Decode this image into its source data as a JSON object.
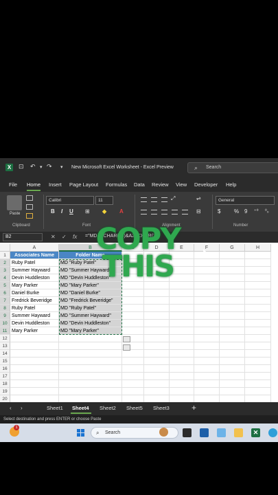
{
  "titlebar": {
    "logo": "X",
    "autosave_icon": "autosave-icon",
    "undo_icon": "undo-icon",
    "redo_icon": "redo-icon",
    "customize_icon": "customize-qat-icon",
    "title": "New Microsoft Excel Worksheet  -  Excel Preview",
    "search_placeholder": "Search"
  },
  "menu": {
    "tabs": [
      "File",
      "Home",
      "Insert",
      "Page Layout",
      "Formulas",
      "Data",
      "Review",
      "View",
      "Developer",
      "Help"
    ],
    "active": "Home"
  },
  "ribbon": {
    "paste_label": "Paste",
    "clipboard_label": "Clipboard",
    "font_name": "Calibri",
    "font_size": "11",
    "font_label": "Font",
    "alignment_label": "Alignment",
    "number_format": "General",
    "number_label": "Number",
    "bold": "B",
    "italic": "I",
    "underline": "U",
    "currency": "$",
    "percent": "%",
    "comma": "9"
  },
  "formula_bar": {
    "name_box": "B2",
    "fx": "fx",
    "formula": "=\"MD \"&CHAR(34)&A2&CHAR(34)"
  },
  "grid": {
    "columns": [
      "A",
      "B",
      "C",
      "D",
      "E",
      "F",
      "G",
      "H"
    ],
    "rows": [
      "1",
      "2",
      "3",
      "4",
      "5",
      "6",
      "7",
      "8",
      "9",
      "10",
      "11",
      "12",
      "13",
      "14",
      "15",
      "16",
      "17",
      "18",
      "19",
      "20"
    ],
    "header_a": "Associates Name",
    "header_b": "Folder Name",
    "names": [
      "Ruby Patel",
      "Summer Hayward",
      "Devin Huddleston",
      "Mary Parker",
      "Daniel Burke",
      "Fredrick Beveridge",
      "Ruby Patel",
      "Summer Hayward",
      "Devin Huddleston",
      "Mary Parker"
    ],
    "folders": [
      "MD \"Ruby Patel\"",
      "MD \"Summer Hayward\"",
      "MD \"Devin Huddleston\"",
      "MD \"Mary Parker\"",
      "MD \"Daniel Burke\"",
      "MD \"Fredrick Beveridge\"",
      "MD \"Ruby Patel\"",
      "MD \"Summer Hayward\"",
      "MD \"Devin Huddleston\"",
      "MD \"Mary Parker\""
    ]
  },
  "overlay": {
    "line1": "COPY",
    "line2": "THIS",
    "color": "#2fa84f"
  },
  "sheets": {
    "tabs": [
      "Sheet1",
      "Sheet4",
      "Sheet2",
      "Sheet5",
      "Sheet3"
    ],
    "active": "Sheet4",
    "add": "+"
  },
  "status": {
    "text": "Select destination and press ENTER or choose Paste"
  },
  "taskbar": {
    "notif_count": "1",
    "search_placeholder": "Search",
    "apps": [
      "mascot-icon",
      "task-view-icon",
      "store-icon",
      "photos-icon",
      "file-explorer-icon",
      "excel-icon",
      "edge-icon"
    ]
  },
  "colors": {
    "accent": "#1d6f42",
    "header_fill": "#4a86c5",
    "selection_fill": "#d4d4d4"
  }
}
